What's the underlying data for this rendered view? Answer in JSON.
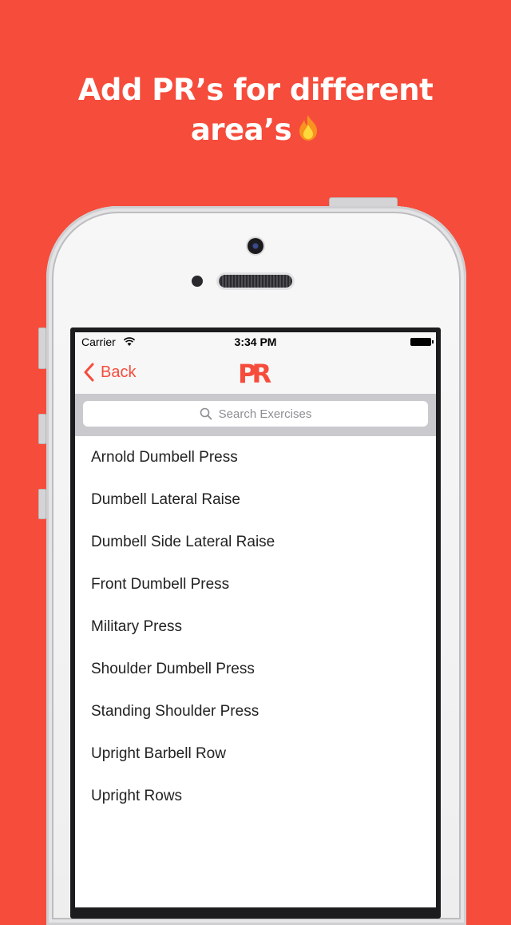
{
  "headline": {
    "line1": "Add PR’s for different",
    "line2": "area’s",
    "emoji_icon": "fire-icon"
  },
  "status_bar": {
    "carrier": "Carrier",
    "time": "3:34 PM"
  },
  "nav": {
    "back_label": "Back",
    "logo_text": "PR"
  },
  "search": {
    "placeholder": "Search Exercises"
  },
  "exercises": [
    "Arnold Dumbell Press",
    "Dumbell Lateral Raise",
    "Dumbell Side Lateral Raise",
    "Front Dumbell Press",
    "Military Press",
    "Shoulder Dumbell Press",
    "Standing Shoulder Press",
    "Upright Barbell Row",
    "Upright Rows"
  ],
  "colors": {
    "background": "#F64C3B",
    "accent": "#F64C3B",
    "text": "#222222"
  }
}
